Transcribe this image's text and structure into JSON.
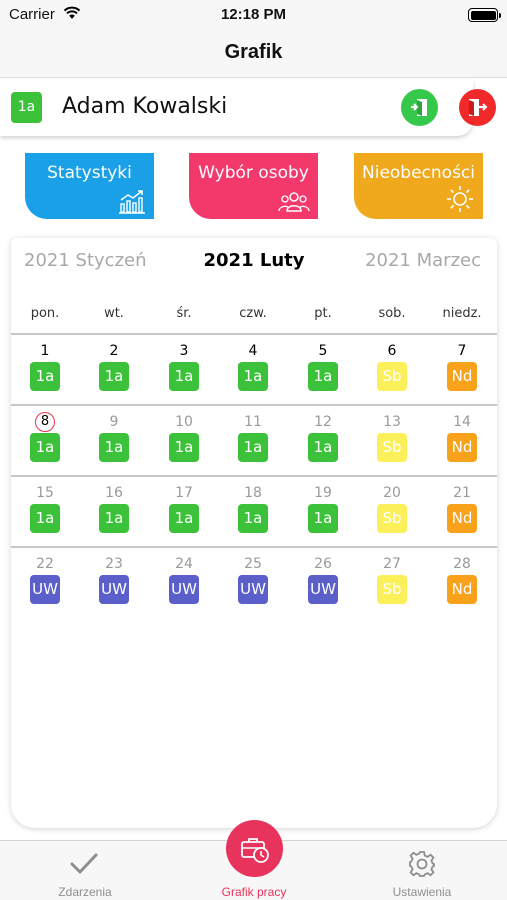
{
  "status_bar": {
    "carrier": "Carrier",
    "time": "12:18 PM"
  },
  "nav": {
    "title": "Grafik"
  },
  "user": {
    "badge": "1a",
    "name": "Adam Kowalski"
  },
  "header_actions": [
    {
      "name": "check-in-icon",
      "color": "#35c84a"
    },
    {
      "name": "check-out-icon",
      "color": "#f02a2a"
    }
  ],
  "cards": [
    {
      "label": "Statystyki",
      "icon": "statistics-icon",
      "color": "#1aa0e6"
    },
    {
      "label": "Wybór osoby",
      "icon": "people-icon",
      "color": "#f3386c"
    },
    {
      "label": "Nieobecności",
      "icon": "sun-icon",
      "color": "#f0a91c"
    }
  ],
  "calendar": {
    "prev_month": "2021 Styczeń",
    "current_month": "2021 Luty",
    "next_month": "2021 Marzec",
    "weekdays": [
      "pon.",
      "wt.",
      "śr.",
      "czw.",
      "pt.",
      "sob.",
      "niedz."
    ],
    "shift_colors": {
      "1a": "#3cc23a",
      "Sb": "#fbf05a",
      "Nd": "#f8a21b",
      "UW": "#5a5fc9"
    },
    "weeks": [
      [
        {
          "day": "1",
          "shift": "1a"
        },
        {
          "day": "2",
          "shift": "1a"
        },
        {
          "day": "3",
          "shift": "1a"
        },
        {
          "day": "4",
          "shift": "1a"
        },
        {
          "day": "5",
          "shift": "1a"
        },
        {
          "day": "6",
          "shift": "Sb"
        },
        {
          "day": "7",
          "shift": "Nd"
        }
      ],
      [
        {
          "day": "8",
          "shift": "1a",
          "today": true
        },
        {
          "day": "9",
          "shift": "1a"
        },
        {
          "day": "10",
          "shift": "1a"
        },
        {
          "day": "11",
          "shift": "1a"
        },
        {
          "day": "12",
          "shift": "1a"
        },
        {
          "day": "13",
          "shift": "Sb"
        },
        {
          "day": "14",
          "shift": "Nd"
        }
      ],
      [
        {
          "day": "15",
          "shift": "1a"
        },
        {
          "day": "16",
          "shift": "1a"
        },
        {
          "day": "17",
          "shift": "1a"
        },
        {
          "day": "18",
          "shift": "1a"
        },
        {
          "day": "19",
          "shift": "1a"
        },
        {
          "day": "20",
          "shift": "Sb"
        },
        {
          "day": "21",
          "shift": "Nd"
        }
      ],
      [
        {
          "day": "22",
          "shift": "UW"
        },
        {
          "day": "23",
          "shift": "UW"
        },
        {
          "day": "24",
          "shift": "UW"
        },
        {
          "day": "25",
          "shift": "UW"
        },
        {
          "day": "26",
          "shift": "UW"
        },
        {
          "day": "27",
          "shift": "Sb"
        },
        {
          "day": "28",
          "shift": "Nd"
        }
      ]
    ]
  },
  "tabs": [
    {
      "label": "Zdarzenia",
      "icon": "checkmark-icon",
      "active": false
    },
    {
      "label": "Grafik pracy",
      "icon": "briefcase-clock-icon",
      "active": true
    },
    {
      "label": "Ustawienia",
      "icon": "gear-icon",
      "active": false
    }
  ]
}
